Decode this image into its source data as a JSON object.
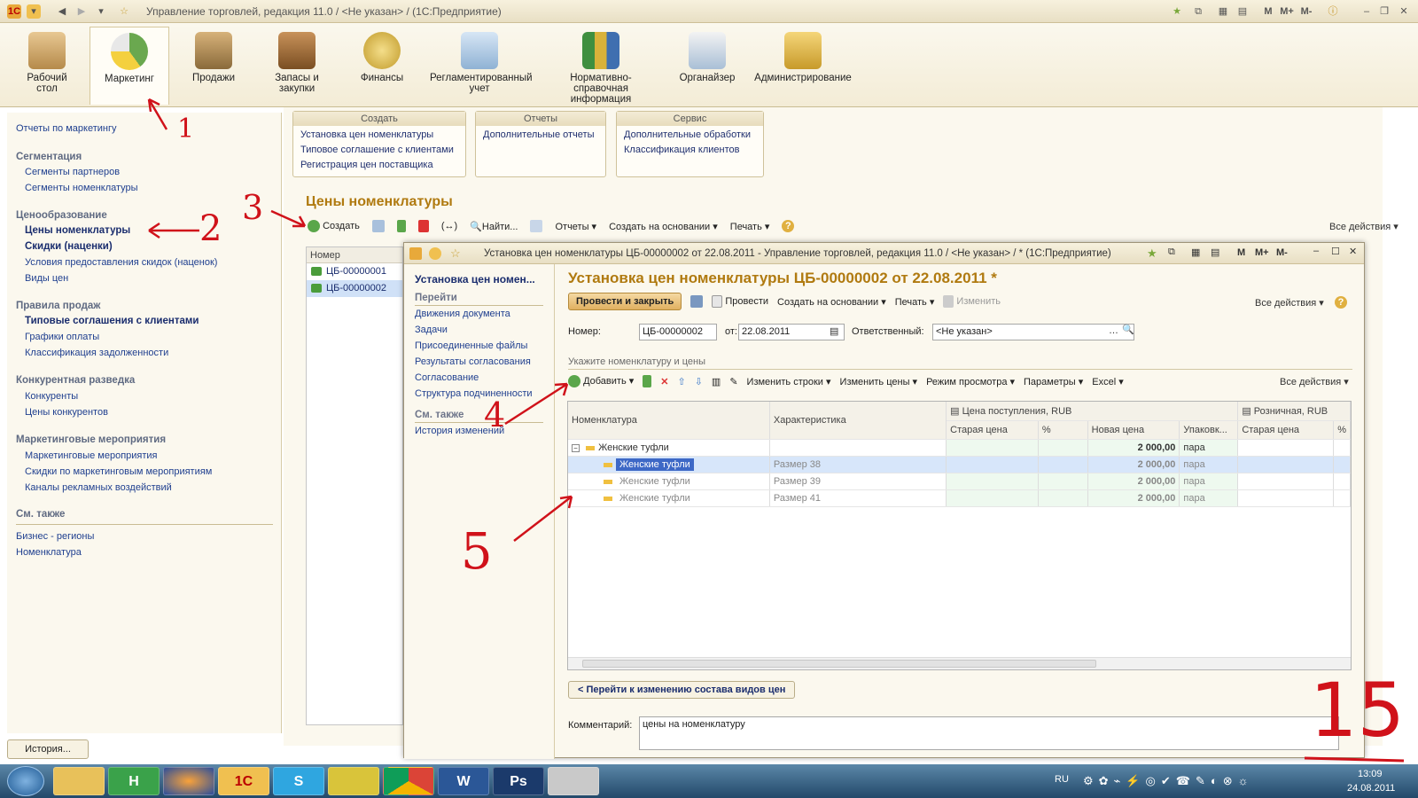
{
  "window": {
    "title": "Управление торговлей, редакция 11.0 / <Не указан> / (1С:Предприятие)",
    "right_buttons": [
      "M",
      "M+",
      "M-"
    ]
  },
  "sections": [
    {
      "label": "Рабочий стол",
      "icon": "desk-icon",
      "color": "#c9a06a"
    },
    {
      "label": "Маркетинг",
      "icon": "pie-chart-icon",
      "color": "#6aa84f"
    },
    {
      "label": "Продажи",
      "icon": "truck-icon",
      "color": "#b58f5a"
    },
    {
      "label": "Запасы и закупки",
      "icon": "boxes-icon",
      "color": "#a0703c"
    },
    {
      "label": "Финансы",
      "icon": "coins-icon",
      "color": "#d9b24a"
    },
    {
      "label": "Регламентированный учет",
      "icon": "documents-icon",
      "color": "#7aa6c9"
    },
    {
      "label": "Нормативно-справочная информация",
      "icon": "binders-icon",
      "color": "#c7a73a"
    },
    {
      "label": "Органайзер",
      "icon": "clipboard-icon",
      "color": "#9bb7d4"
    },
    {
      "label": "Администрирование",
      "icon": "database-icon",
      "color": "#e2b84a"
    }
  ],
  "left_nav": {
    "top_link": "Отчеты по маркетингу",
    "groups": [
      {
        "title": "Сегментация",
        "items": [
          {
            "label": "Сегменты партнеров"
          },
          {
            "label": "Сегменты номенклатуры"
          }
        ]
      },
      {
        "title": "Ценообразование",
        "items": [
          {
            "label": "Цены номенклатуры",
            "bold": true
          },
          {
            "label": "Скидки (наценки)",
            "bold": true
          },
          {
            "label": "Условия предоставления скидок (наценок)"
          },
          {
            "label": "Виды цен"
          }
        ]
      },
      {
        "title": "Правила продаж",
        "items": [
          {
            "label": "Типовые соглашения с клиентами",
            "bold": true
          },
          {
            "label": "Графики оплаты"
          },
          {
            "label": "Классификация задолженности"
          }
        ]
      },
      {
        "title": "Конкурентная разведка",
        "items": [
          {
            "label": "Конкуренты"
          },
          {
            "label": "Цены конкурентов"
          }
        ]
      },
      {
        "title": "Маркетинговые мероприятия",
        "items": [
          {
            "label": "Маркетинговые мероприятия"
          },
          {
            "label": "Скидки по маркетинговым мероприятиям"
          },
          {
            "label": "Каналы рекламных воздействий"
          }
        ]
      }
    ],
    "see_also_title": "См. также",
    "see_also": [
      "Бизнес - регионы",
      "Номенклатура"
    ]
  },
  "panels": [
    {
      "title": "Создать",
      "items": [
        "Установка цен номенклатуры",
        "Типовое соглашение с клиентами",
        "Регистрация цен поставщика"
      ]
    },
    {
      "title": "Отчеты",
      "items": [
        "Дополнительные отчеты"
      ]
    },
    {
      "title": "Сервис",
      "items": [
        "Дополнительные обработки",
        "Классификация клиентов"
      ]
    }
  ],
  "list_form": {
    "title": "Цены номенклатуры",
    "toolbar": {
      "create": "Создать",
      "find": "Найти...",
      "reports": "Отчеты",
      "create_based": "Создать на основании",
      "print": "Печать",
      "all_actions": "Все действия"
    },
    "column": "Номер",
    "rows": [
      "ЦБ-00000001",
      "ЦБ-00000002"
    ]
  },
  "history_button": "История...",
  "doc_window": {
    "title": "Установка цен номенклатуры ЦБ-00000002 от 22.08.2011 - Управление торговлей, редакция 11.0 / <Не указан> / * (1С:Предприятие)",
    "buttons": [
      "M",
      "M+",
      "M-"
    ],
    "nav": {
      "current": "Установка цен номен...",
      "goto_title": "Перейти",
      "goto_items": [
        "Движения документа",
        "Задачи",
        "Присоединенные файлы",
        "Результаты согласования",
        "Согласование",
        "Структура подчиненности"
      ],
      "see_also_title": "См. также",
      "see_also_items": [
        "История изменений"
      ]
    },
    "heading": "Установка цен номенклатуры ЦБ-00000002 от 22.08.2011 *",
    "toolbar": {
      "post_close": "Провести и закрыть",
      "post": "Провести",
      "create_based": "Создать на основании",
      "print": "Печать",
      "edit": "Изменить",
      "all_actions": "Все действия"
    },
    "fields": {
      "number_label": "Номер:",
      "number": "ЦБ-00000002",
      "date_label": "от:",
      "date": "22.08.2011",
      "resp_label": "Ответственный:",
      "resp": "<Не указан>"
    },
    "hint": "Укажите номенклатуру и цены",
    "table_toolbar": {
      "add": "Добавить",
      "change_rows": "Изменить строки",
      "change_prices": "Изменить цены",
      "view_mode": "Режим просмотра",
      "params": "Параметры",
      "excel": "Excel",
      "all_actions": "Все действия"
    },
    "table": {
      "headers": {
        "nomenclature": "Номенклатура",
        "characteristic": "Характеристика",
        "receipt_price": "Цена поступления, RUB",
        "retail": "Розничная, RUB",
        "old_price": "Старая цена",
        "pct": "%",
        "new_price": "Новая цена",
        "pack": "Упаковк...",
        "old_price2": "Старая цена",
        "pct2": "%"
      },
      "rows": [
        {
          "name": "Женские туфли",
          "char": "",
          "new_price": "2 000,00",
          "pack": "пара"
        },
        {
          "name": "Женские туфли",
          "char": "Размер 38",
          "new_price": "2 000,00",
          "pack": "пара"
        },
        {
          "name": "Женские туфли",
          "char": "Размер 39",
          "new_price": "2 000,00",
          "pack": "пара"
        },
        {
          "name": "Женские туфли",
          "char": "Размер 41",
          "new_price": "2 000,00",
          "pack": "пара"
        }
      ]
    },
    "goto_button": "< Перейти к изменению состава видов цен",
    "comment_label": "Комментарий:",
    "comment": "цены на номенклатуру"
  },
  "annotations": {
    "a1": "1",
    "a2": "2",
    "a3": "3",
    "a4": "4",
    "a5": "5",
    "big": "15"
  },
  "taskbar": {
    "lang": "RU",
    "time": "13:09",
    "date": "24.08.2011"
  },
  "colors": {
    "accent": "#b07a10",
    "link": "#1f3f8f",
    "annotation": "#d0121a"
  }
}
